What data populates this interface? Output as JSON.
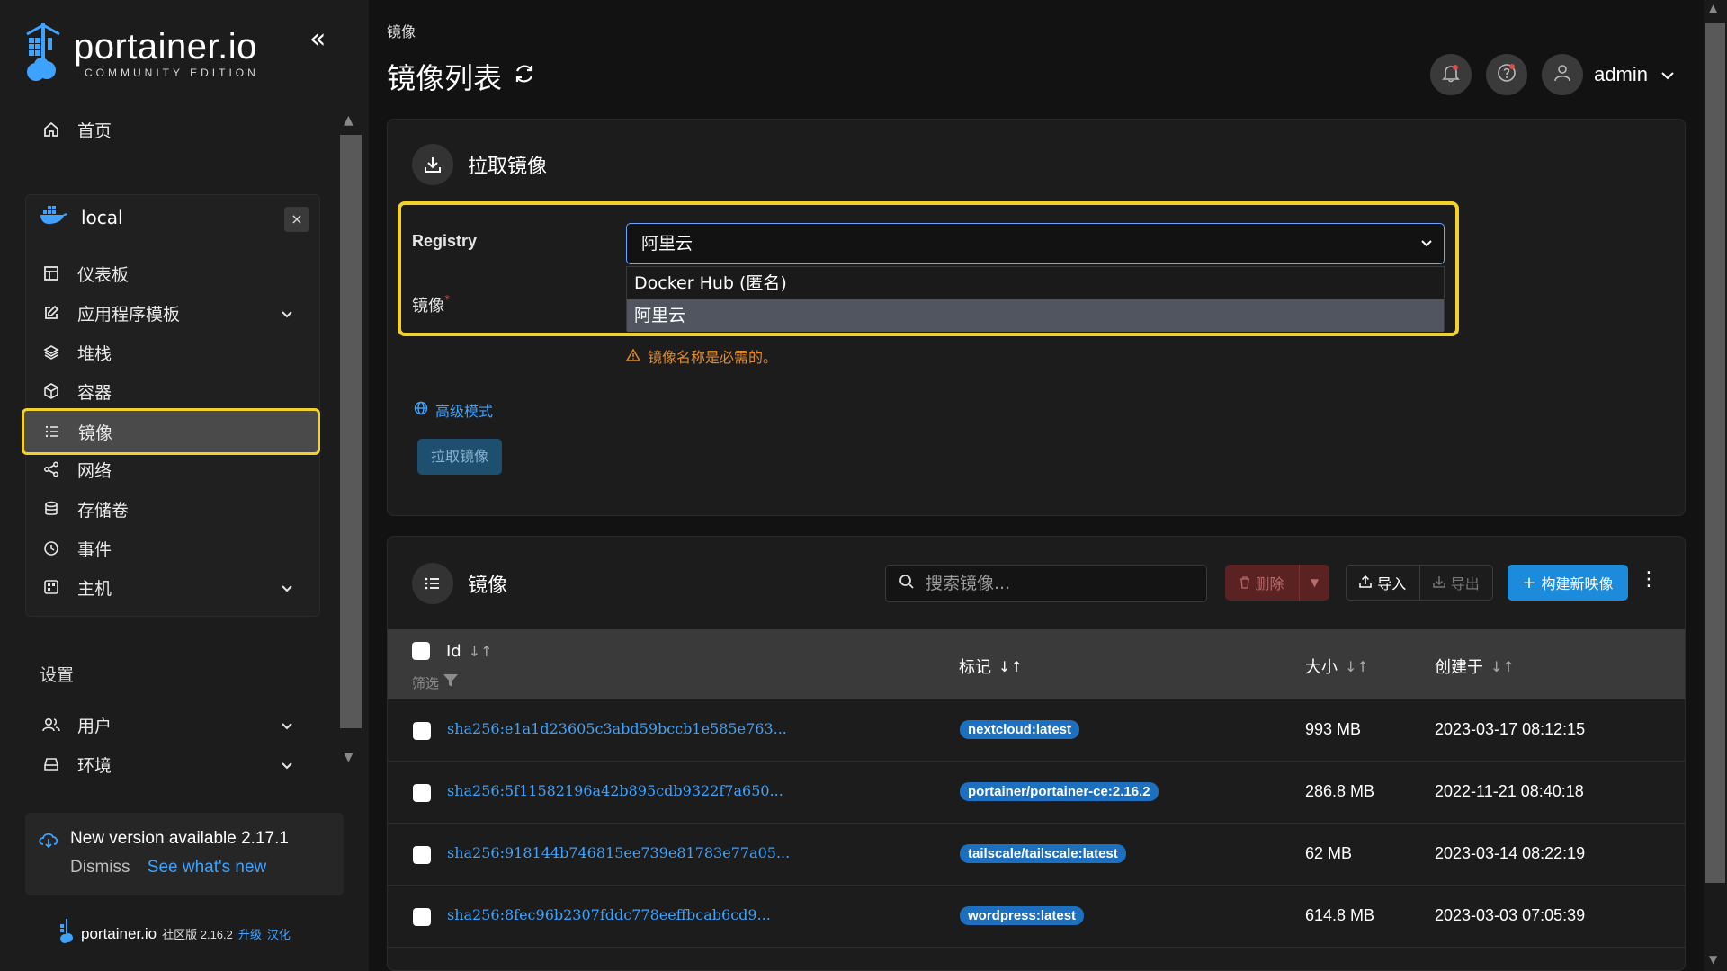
{
  "brand": {
    "title": "portainer.io",
    "subtitle": "COMMUNITY EDITION"
  },
  "sidebar": {
    "home": "首页",
    "environment": {
      "name": "local",
      "close": "×"
    },
    "items": [
      {
        "label": "仪表板",
        "icon": "dashboard-icon"
      },
      {
        "label": "应用程序模板",
        "icon": "edit-icon",
        "expandable": true
      },
      {
        "label": "堆栈",
        "icon": "layers-icon"
      },
      {
        "label": "容器",
        "icon": "cube-icon"
      },
      {
        "label": "镜像",
        "icon": "list-icon",
        "active": true
      },
      {
        "label": "网络",
        "icon": "share-icon"
      },
      {
        "label": "存储卷",
        "icon": "database-icon"
      },
      {
        "label": "事件",
        "icon": "clock-icon"
      },
      {
        "label": "主机",
        "icon": "host-icon",
        "expandable": true
      }
    ],
    "settings_label": "设置",
    "settings_items": [
      {
        "label": "用户",
        "icon": "users-icon",
        "expandable": true
      },
      {
        "label": "环境",
        "icon": "drive-icon",
        "expandable": true
      }
    ],
    "update": {
      "title": "New version available 2.17.1",
      "dismiss": "Dismiss",
      "see_new": "See what's new"
    },
    "footer": {
      "brand": "portainer.io",
      "edition": "社区版 2.16.2",
      "upgrade": "升级",
      "localize": "汉化"
    }
  },
  "header": {
    "breadcrumb": "镜像",
    "title": "镜像列表",
    "user": "admin"
  },
  "pull_panel": {
    "title": "拉取镜像",
    "registry_label": "Registry",
    "registry_value": "阿里云",
    "registry_options": [
      "Docker Hub (匿名)",
      "阿里云"
    ],
    "image_label": "镜像",
    "required_mark": "*",
    "warning": "镜像名称是必需的。",
    "advanced": "高级模式",
    "pull_button": "拉取镜像"
  },
  "images_panel": {
    "title": "镜像",
    "search_placeholder": "搜索镜像...",
    "delete_button": "删除",
    "import_button": "导入",
    "export_button": "导出",
    "build_button": "构建新映像",
    "columns": {
      "id": "Id",
      "tags": "标记",
      "size": "大小",
      "created": "创建于",
      "filter": "筛选"
    },
    "rows": [
      {
        "id": "sha256:e1a1d23605c3abd59bccb1e585e763...",
        "tag": "nextcloud:latest",
        "size": "993 MB",
        "created": "2023-03-17 08:12:15"
      },
      {
        "id": "sha256:5f11582196a42b895cdb9322f7a650...",
        "tag": "portainer/portainer-ce:2.16.2",
        "size": "286.8 MB",
        "created": "2022-11-21 08:40:18"
      },
      {
        "id": "sha256:918144b746815ee739e81783e77a05...",
        "tag": "tailscale/tailscale:latest",
        "size": "62 MB",
        "created": "2023-03-14 08:22:19"
      },
      {
        "id": "sha256:8fec96b2307fddc778eeffbcab6cd9...",
        "tag": "wordpress:latest",
        "size": "614.8 MB",
        "created": "2023-03-03 07:05:39"
      }
    ]
  },
  "colors": {
    "accent": "#1d8bdb",
    "highlight": "#f2d22a",
    "link": "#3ea3ff",
    "tag_bg": "#1d6fc0",
    "warning": "#e08a2a"
  }
}
